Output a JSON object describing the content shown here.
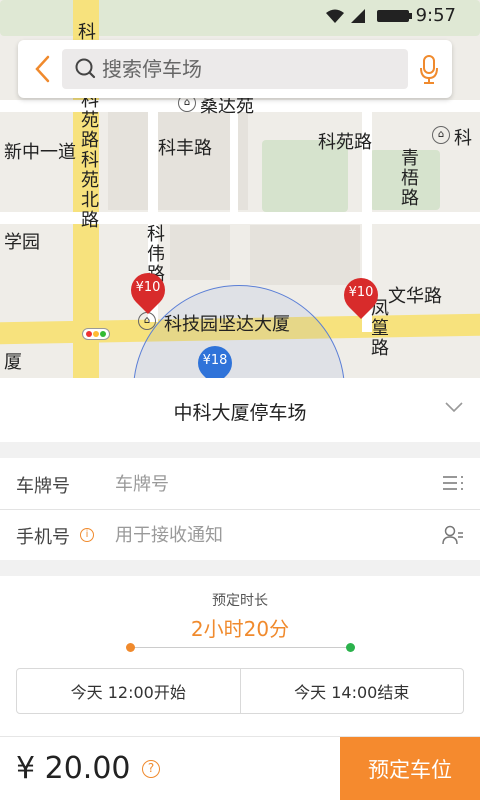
{
  "status_bar": {
    "time": "9:57",
    "icons": [
      "wifi-icon",
      "signal-icon",
      "battery-icon"
    ]
  },
  "search": {
    "placeholder": "搜索停车场",
    "value": ""
  },
  "map": {
    "labels": [
      {
        "name": "科苑路-vertical",
        "text": "科苑路科苑北路"
      },
      {
        "name": "科",
        "text": "科"
      },
      {
        "name": "桑达苑",
        "text": "桑达苑"
      },
      {
        "name": "科丰路",
        "text": "科丰路"
      },
      {
        "name": "科苑路",
        "text": "科苑路"
      },
      {
        "name": "科edge",
        "text": "科"
      },
      {
        "name": "新中一道",
        "text": "新中一道"
      },
      {
        "name": "青梧路",
        "text": "青梧路"
      },
      {
        "name": "学园",
        "text": "学园"
      },
      {
        "name": "科伟路",
        "text": "科伟路"
      },
      {
        "name": "文华路",
        "text": "文华路"
      },
      {
        "name": "科技园坚达大厦",
        "text": "科技园坚达大厦"
      },
      {
        "name": "凤篁路",
        "text": "凤篁路"
      },
      {
        "name": "厦",
        "text": "厦"
      }
    ],
    "pins": [
      {
        "label": "¥10",
        "color": "#d82b2b"
      },
      {
        "label": "¥10",
        "color": "#d82b2b"
      },
      {
        "label": "¥18",
        "color": "#2f73d9"
      }
    ]
  },
  "lot": {
    "name": "中科大厦停车场"
  },
  "form": {
    "plate_label": "车牌号",
    "plate_placeholder": "车牌号",
    "phone_label": "手机号",
    "phone_placeholder": "用于接收通知"
  },
  "duration": {
    "label": "预定时长",
    "value": "2小时20分",
    "start": "今天 12:00开始",
    "end": "今天 14:00结束",
    "start_color": "#f08a2d",
    "end_color": "#2bb24c"
  },
  "footer": {
    "price": "¥ 20.00",
    "help": "?",
    "book_label": "预定车位"
  },
  "colors": {
    "accent": "#f58a2e"
  }
}
